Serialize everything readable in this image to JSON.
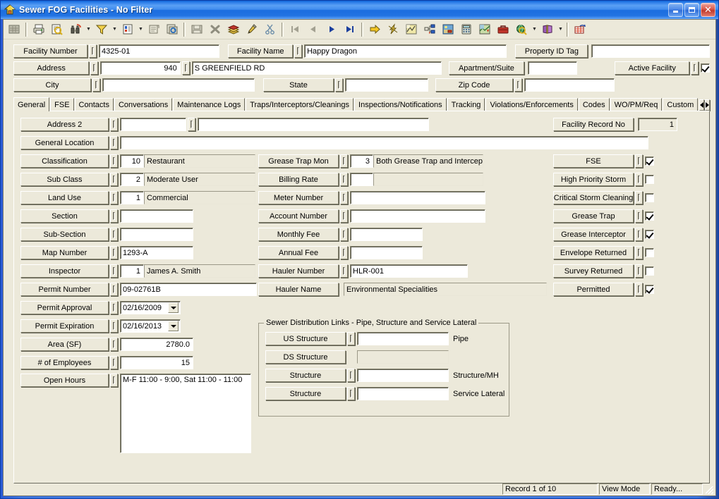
{
  "window": {
    "title": "Sewer FOG Facilities - No Filter",
    "icon": "house-icon",
    "minimize_label": "Minimize",
    "maximize_label": "Maximize",
    "close_label": "Close"
  },
  "toolbar": {
    "buttons": [
      {
        "name": "datasheet-view-icon",
        "tip": "Datasheet View"
      },
      {
        "name": "print-icon",
        "tip": "Print"
      },
      {
        "name": "print-preview-icon",
        "tip": "Print Preview"
      },
      {
        "name": "find-binoculars-icon",
        "tip": "Find",
        "dropdown": true
      },
      {
        "name": "filter-funnel-icon",
        "tip": "Filter",
        "dropdown": true
      },
      {
        "name": "report-icon",
        "tip": "Report",
        "dropdown": true
      },
      {
        "name": "properties-icon",
        "tip": "Properties"
      },
      {
        "name": "refresh-icon",
        "tip": "Refresh"
      },
      {
        "name": "save-icon",
        "tip": "Save"
      },
      {
        "name": "delete-x-icon",
        "tip": "Delete"
      },
      {
        "name": "stack-icon",
        "tip": "Add Record"
      },
      {
        "name": "edit-pencil-icon",
        "tip": "Edit"
      },
      {
        "name": "cut-scissors-icon",
        "tip": "Cut"
      },
      {
        "name": "first-record-icon",
        "tip": "First Record"
      },
      {
        "name": "previous-record-icon",
        "tip": "Previous Record"
      },
      {
        "name": "next-record-icon",
        "tip": "Next Record"
      },
      {
        "name": "last-record-icon",
        "tip": "Last Record"
      },
      {
        "name": "goto-arrow-icon",
        "tip": "Go To"
      },
      {
        "name": "lightning-icon",
        "tip": "Quick Action"
      },
      {
        "name": "map-layers-icon",
        "tip": "Map"
      },
      {
        "name": "hierarchy-icon",
        "tip": "Hierarchy"
      },
      {
        "name": "image-icon",
        "tip": "Images"
      },
      {
        "name": "calculator-icon",
        "tip": "Calculator"
      },
      {
        "name": "gis-map-icon",
        "tip": "GIS Map"
      },
      {
        "name": "toolbox-icon",
        "tip": "Toolbox"
      },
      {
        "name": "globe-search-icon",
        "tip": "Web Lookup",
        "dropdown": true
      },
      {
        "name": "book-icon",
        "tip": "Help Book",
        "dropdown": true
      },
      {
        "name": "export-icon",
        "tip": "Export"
      }
    ]
  },
  "header": {
    "facility_number": {
      "label": "Facility Number",
      "value": "4325-01"
    },
    "facility_name": {
      "label": "Facility Name",
      "value": "Happy Dragon"
    },
    "property_id_tag": {
      "label": "Property ID Tag",
      "value": ""
    },
    "address": {
      "label": "Address",
      "number": "940",
      "street": "S GREENFIELD RD"
    },
    "apartment_suite": {
      "label": "Apartment/Suite",
      "value": ""
    },
    "active_facility": {
      "label": "Active Facility",
      "checked": true
    },
    "city": {
      "label": "City",
      "value": ""
    },
    "state": {
      "label": "State",
      "value": ""
    },
    "zip_code": {
      "label": "Zip Code",
      "value": ""
    }
  },
  "tabs": {
    "items": [
      "General",
      "FSE",
      "Contacts",
      "Conversations",
      "Maintenance Logs",
      "Traps/Interceptors/Cleanings",
      "Inspections/Notifications",
      "Tracking",
      "Violations/Enforcements",
      "Codes",
      "WO/PM/Req",
      "Custom"
    ],
    "active": "General",
    "scroll_left": "◄",
    "scroll_right": "►"
  },
  "general": {
    "left_column": [
      {
        "label": "Address 2",
        "code": "",
        "value": "",
        "type": "dual"
      },
      {
        "label": "General Location",
        "code": "",
        "value": "",
        "type": "wide"
      },
      {
        "label": "Classification",
        "code": "10",
        "value": "Restaurant",
        "type": "code"
      },
      {
        "label": "Sub Class",
        "code": "2",
        "value": "Moderate User",
        "type": "code"
      },
      {
        "label": "Land Use",
        "code": "1",
        "value": "Commercial",
        "type": "code"
      },
      {
        "label": "Section",
        "code": "",
        "value": "",
        "type": "short"
      },
      {
        "label": "Sub-Section",
        "code": "",
        "value": "",
        "type": "short"
      },
      {
        "label": "Map Number",
        "code": "",
        "value": "1293-A",
        "type": "short"
      },
      {
        "label": "Inspector",
        "code": "1",
        "value": "James A. Smith",
        "type": "code"
      },
      {
        "label": "Permit Number",
        "code": "",
        "value": "09-02761B",
        "type": "medium"
      },
      {
        "label": "Permit Approval",
        "code": "",
        "value": "02/16/2009",
        "type": "date"
      },
      {
        "label": "Permit Expiration",
        "code": "",
        "value": "02/16/2013",
        "type": "date"
      },
      {
        "label": "Area (SF)",
        "code": "",
        "value": "2780.0",
        "type": "number"
      },
      {
        "label": "# of Employees",
        "code": "",
        "value": "15",
        "type": "number"
      },
      {
        "label": "Open Hours",
        "code": "",
        "value": "M-F 11:00 - 9:00, Sat 11:00 - 11:00",
        "type": "memo"
      }
    ],
    "middle_column": [
      {
        "label": "Grease Trap Mon",
        "code": "3",
        "value": "Both Grease Trap and Intercept",
        "type": "code"
      },
      {
        "label": "Billing Rate",
        "code": "",
        "value": "",
        "type": "code_ro"
      },
      {
        "label": "Meter Number",
        "code": "",
        "value": "",
        "type": "wide"
      },
      {
        "label": "Account Number",
        "code": "",
        "value": "",
        "type": "wide"
      },
      {
        "label": "Monthly Fee",
        "code": "",
        "value": "",
        "type": "medium"
      },
      {
        "label": "Annual Fee",
        "code": "",
        "value": "",
        "type": "medium"
      },
      {
        "label": "Hauler Number",
        "code": "",
        "value": "HLR-001",
        "type": "medium"
      },
      {
        "label": "Hauler Name",
        "code": "",
        "value": "Environmental Specialities",
        "type": "nonav"
      }
    ],
    "facility_record_no": {
      "label": "Facility Record No",
      "value": "1"
    },
    "right_column": [
      {
        "label": "FSE",
        "checked": true
      },
      {
        "label": "High Priority Storm",
        "checked": false
      },
      {
        "label": "Critical Storm Cleaning",
        "checked": false
      },
      {
        "label": "Grease Trap",
        "checked": true
      },
      {
        "label": "Grease Interceptor",
        "checked": true
      },
      {
        "label": "Envelope Returned",
        "checked": false
      },
      {
        "label": "Survey Returned",
        "checked": false
      },
      {
        "label": "Permitted",
        "checked": true
      }
    ],
    "sewer_links": {
      "caption": "Sewer Distribution Links - Pipe, Structure and Service Lateral",
      "rows": [
        {
          "label": "US Structure",
          "value": "",
          "suffix": "Pipe",
          "nav": true
        },
        {
          "label": "DS Structure",
          "value": "",
          "suffix": "",
          "nav": false
        },
        {
          "label": "Structure",
          "value": "",
          "suffix": "Structure/MH",
          "nav": true
        },
        {
          "label": "Structure",
          "value": "",
          "suffix": "Service Lateral",
          "nav": true
        }
      ]
    }
  },
  "statusbar": {
    "record": "Record 1 of 10",
    "mode": "View Mode",
    "state": "Ready..."
  },
  "colors": {
    "face": "#ece9da",
    "titlebar_blue": "#3c74e0",
    "field_bg": "#ffffff",
    "border_dark": "#85836f"
  }
}
